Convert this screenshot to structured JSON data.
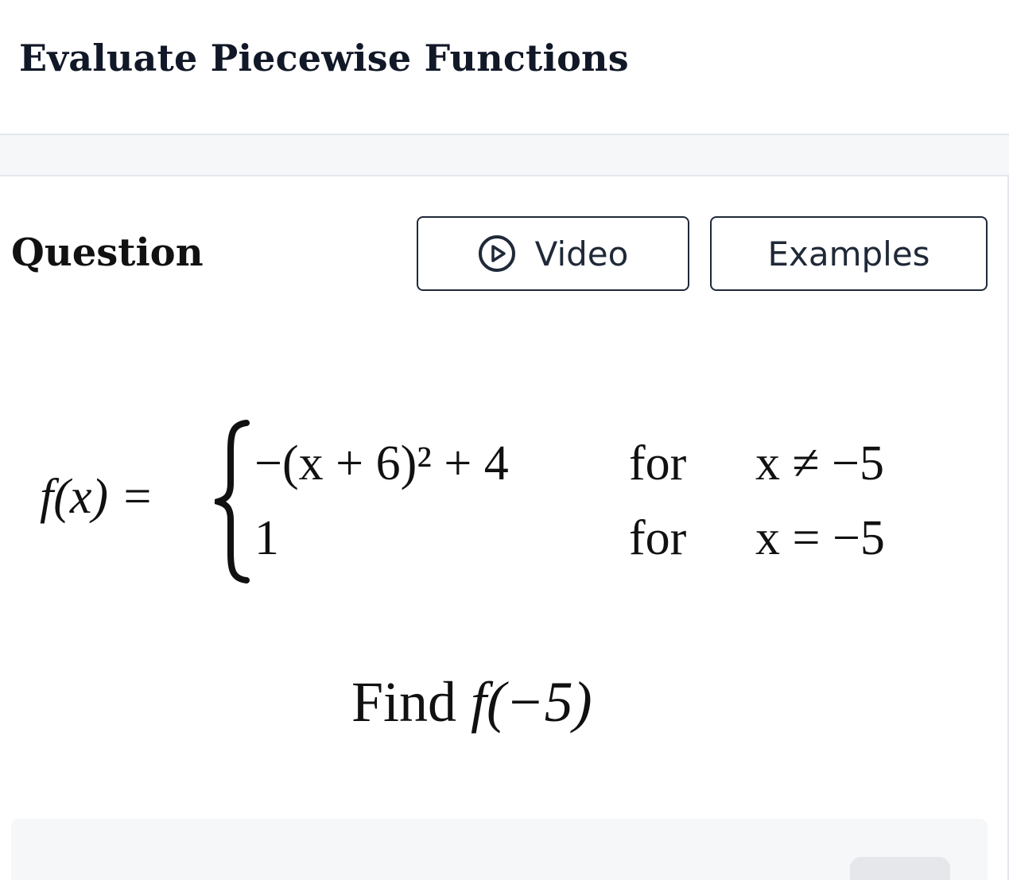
{
  "page": {
    "title": "Evaluate Piecewise Functions"
  },
  "question": {
    "heading": "Question",
    "video_button": {
      "label": "Video",
      "icon": "play-circle-icon"
    },
    "examples_button": {
      "label": "Examples"
    }
  },
  "problem": {
    "function_lhs": "f(x) =",
    "cases": [
      {
        "expression": "−(x + 6)² + 4",
        "word": "for",
        "condition": "x ≠ −5"
      },
      {
        "expression": "1",
        "word": "for",
        "condition": "x = −5"
      }
    ],
    "prompt_word": "Find",
    "prompt_expr": "f(−5)"
  },
  "colors": {
    "text": "#111827",
    "band": "#f6f7f9",
    "divider": "#e3e7ed",
    "button_border": "#1f2937"
  }
}
